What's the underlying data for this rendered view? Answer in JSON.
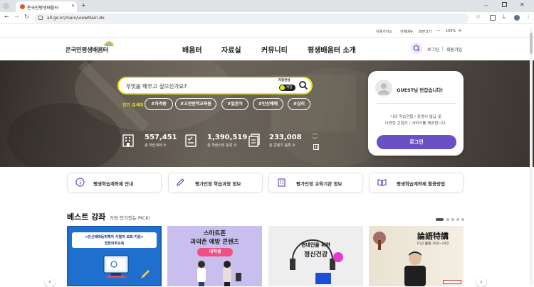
{
  "browser": {
    "tab_title": "온국민평생배움터",
    "url": "all.go.kr/main/viewMain.do"
  },
  "util_links": {
    "guide": "이용가이드",
    "sitemap": "전체메뉴",
    "zoom_label": "화면크기",
    "zoom_minus": "−",
    "zoom_value": "100%",
    "zoom_plus": "+"
  },
  "header": {
    "logo": "온국민평생배움터",
    "nav": [
      "배움터",
      "자료실",
      "커뮤니티",
      "평생배움터 소개"
    ],
    "login": "로그인",
    "signup": "회원가입"
  },
  "hero": {
    "search_placeholder": "무엇을 배우고 싶으신가요?",
    "autocomplete_label": "자동완성",
    "autocomplete_state": "켜짐",
    "popular_label": "인기 검색어",
    "tags": [
      "#자격증",
      "#고전번역교육원",
      "#일본어",
      "#인신매매",
      "#심리"
    ],
    "stats": [
      {
        "value": "557,451",
        "label": "총 학습계좌 수"
      },
      {
        "value": "1,390,519",
        "label": "총 학습이력 등록 수"
      },
      {
        "value": "233,008",
        "label": "총 콘텐츠 등록 수"
      }
    ]
  },
  "login_card": {
    "greeting": "GUEST님 반갑습니다!",
    "desc_line1": "나의 학습현황 / 증명서 발급 및",
    "desc_line2": "다양한 콘텐츠 / 서비스를 제공합니다.",
    "button": "로그인"
  },
  "quick_cards": [
    {
      "label": "평생학습계좌제 안내",
      "icon": "info-icon"
    },
    {
      "label": "평가인정 학습과정 정보",
      "icon": "pencil-icon"
    },
    {
      "label": "평가인정 교육기관 정보",
      "icon": "building-icon"
    },
    {
      "label": "평생학습계좌제 활용방법",
      "icon": "book-icon"
    }
  ],
  "best": {
    "title": "베스트 강좌",
    "subtitle": "가장 인기있는 PICK!",
    "thumbs": [
      {
        "line1": "<인신매매등피해자 식별과 보호·지원>",
        "line2": "법정의무교육"
      },
      {
        "line1": "스마트폰",
        "line2": "과의존 예방 콘텐츠",
        "badge": "대학생"
      },
      {
        "line1": "현대인을 위한",
        "line2": "정신건강"
      },
      {
        "line1": "論語特講",
        "line2": "15강 論語 16강~24강"
      }
    ]
  },
  "colors": {
    "accent_purple": "#6b4fc4",
    "search_border": "#e6e60d",
    "thumb1_bg": "#1f6fcf",
    "thumb2_bg": "#c9bfee"
  }
}
